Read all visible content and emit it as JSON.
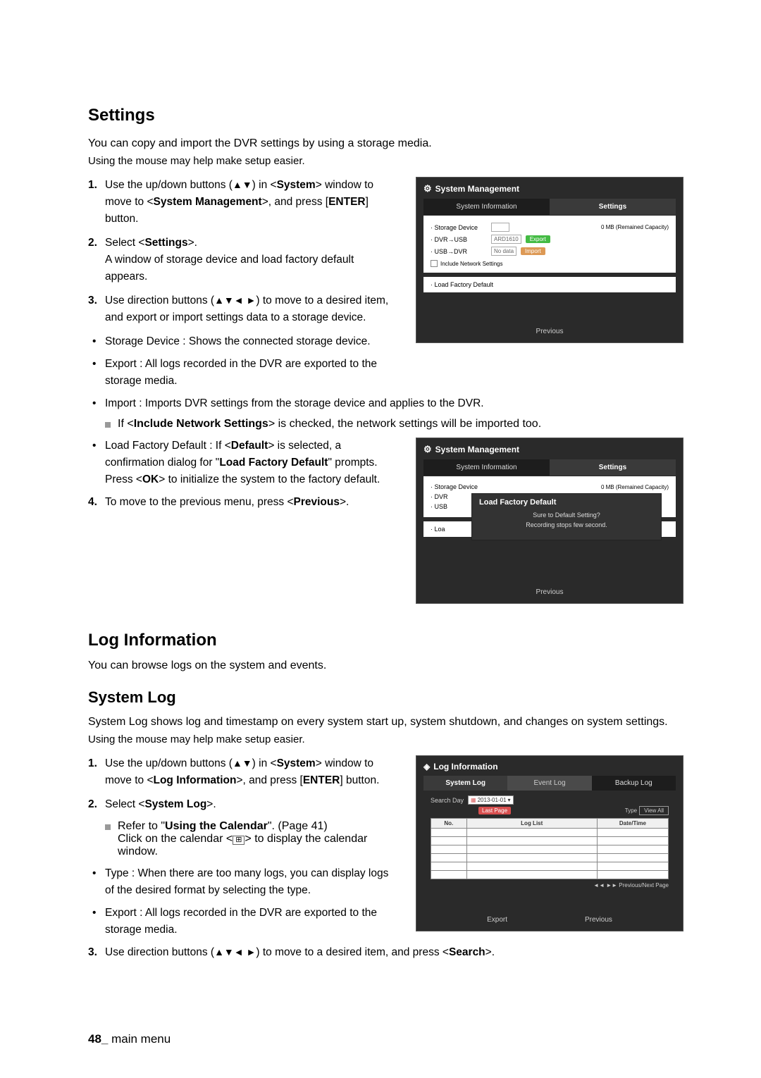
{
  "settings": {
    "heading": "Settings",
    "intro": "You can copy and import the DVR settings by using a storage media.",
    "mouse": "Using the mouse may help make setup easier.",
    "steps": [
      {
        "n": "1.",
        "t": "Use the up/down buttons (▲▼) in <System> window to move to <System Management>, and press [ENTER] button.",
        "bold_map": [
          "System",
          "System Management",
          "ENTER"
        ]
      },
      {
        "n": "2.",
        "t": "Select <Settings>.\nA window of storage device and load factory default appears."
      },
      {
        "n": "3.",
        "t": "Use direction buttons (▲▼◄ ►) to move to a desired item, and export or import settings data to a storage device."
      }
    ],
    "bullets": [
      "Storage Device : Shows the connected storage device.",
      "Export : All logs recorded in the DVR are exported to the storage media.",
      "Import : Imports DVR settings from the storage device and applies to the DVR."
    ],
    "note": "If <Include Network Settings> is checked, the network settings will be imported too.",
    "bullets2": [
      "Load Factory Default : If <Default> is selected, a confirmation dialog for \"Load Factory Default\" prompts. Press <OK> to initialize the system to the factory default."
    ],
    "step4": {
      "n": "4.",
      "t": "To move to the previous menu, press <Previous>."
    }
  },
  "shot1": {
    "title": "System Management",
    "tab1": "System Information",
    "tab2": "Settings",
    "sd": "· Storage Device",
    "cap": "0 MB (Remained Capacity)",
    "r1": "· DVR→USB",
    "r1v": "ARD1610",
    "r1b": "Export",
    "r2": "· USB→DVR",
    "r2v": "No data",
    "r2b": "Import",
    "inc": "Include Network Settings",
    "lfd": "· Load Factory Default",
    "prev": "Previous"
  },
  "shot2": {
    "title": "System Management",
    "tab1": "System Information",
    "tab2": "Settings",
    "sd": "· Storage Device",
    "cap": "0 MB (Remained Capacity)",
    "r1": "· DVR",
    "r2": "· USB",
    "r3": "· Loa",
    "dlg_title": "Load Factory Default",
    "dlg_l1": "Sure to Default Setting?",
    "dlg_l2": "Recording stops few second.",
    "prev": "Previous"
  },
  "loginfo": {
    "heading": "Log Information",
    "intro": "You can browse logs on the system and events.",
    "sub": "System Log",
    "p": "System Log shows log and timestamp on every system start up, system shutdown, and changes on system settings.",
    "mouse": "Using the mouse may help make setup easier.",
    "steps": [
      {
        "n": "1.",
        "t": "Use the up/down buttons (▲▼) in <System> window to move to <Log Information>, and press [ENTER] button."
      },
      {
        "n": "2.",
        "t": "Select <System Log>."
      }
    ],
    "note1": "Refer to \"Using the Calendar\". (Page 41)",
    "note2": "Click on the calendar < ⌸ > to display the calendar window.",
    "bullets": [
      "Type : When there are too many logs, you can display logs of the desired format by selecting the type.",
      "Export : All logs recorded in the DVR are exported to the storage media."
    ],
    "step3": {
      "n": "3.",
      "t": "Use direction buttons (▲▼◄ ►) to move to a desired item, and press <Search>."
    }
  },
  "shot3": {
    "title": "Log Information",
    "tab1": "System Log",
    "tab2": "Event Log",
    "tab3": "Backup Log",
    "sd": "Search Day",
    "date": "2013-01-01",
    "fp": "Last Page",
    "type": "Type",
    "va": "View All",
    "c1": "No.",
    "c2": "Log List",
    "c3": "Date/Time",
    "pnp": "◄◄ ►► Previous/Next Page",
    "exp": "Export",
    "prev": "Previous"
  },
  "footer": {
    "page": "48_",
    "label": "main menu"
  }
}
